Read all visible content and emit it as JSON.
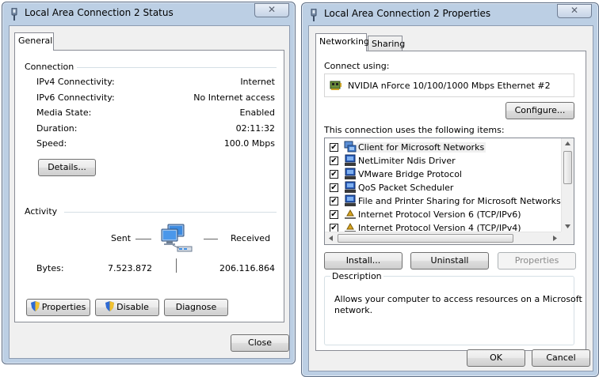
{
  "status_window": {
    "title": "Local Area Connection 2 Status",
    "close_glyph": "✕",
    "tab": "General",
    "connection": {
      "heading": "Connection",
      "rows": [
        {
          "label": "IPv4 Connectivity:",
          "value": "Internet"
        },
        {
          "label": "IPv6 Connectivity:",
          "value": "No Internet access"
        },
        {
          "label": "Media State:",
          "value": "Enabled"
        },
        {
          "label": "Duration:",
          "value": "02:11:32"
        },
        {
          "label": "Speed:",
          "value": "100.0 Mbps"
        }
      ],
      "details_button": "Details..."
    },
    "activity": {
      "heading": "Activity",
      "sent_label": "Sent",
      "received_label": "Received",
      "bytes_label": "Bytes:",
      "bytes_sent": "7.523.872",
      "bytes_received": "206.116.864"
    },
    "buttons": {
      "properties": "Properties",
      "disable": "Disable",
      "diagnose": "Diagnose",
      "close": "Close"
    }
  },
  "properties_window": {
    "title": "Local Area Connection 2 Properties",
    "close_glyph": "✕",
    "tabs": [
      "Networking",
      "Sharing"
    ],
    "connect_using_label": "Connect using:",
    "adapter_name": "NVIDIA nForce 10/100/1000 Mbps Ethernet #2",
    "configure_button": "Configure...",
    "items_label": "This connection uses the following items:",
    "items": [
      {
        "label": "Client for Microsoft Networks",
        "checked": true,
        "icon": "network-client-icon"
      },
      {
        "label": "NetLimiter Ndis Driver",
        "checked": true,
        "icon": "network-service-icon"
      },
      {
        "label": "VMware Bridge Protocol",
        "checked": true,
        "icon": "network-service-icon"
      },
      {
        "label": "QoS Packet Scheduler",
        "checked": true,
        "icon": "network-service-icon"
      },
      {
        "label": "File and Printer Sharing for Microsoft Networks",
        "checked": true,
        "icon": "network-service-icon"
      },
      {
        "label": "Internet Protocol Version 6 (TCP/IPv6)",
        "checked": true,
        "icon": "protocol-icon"
      },
      {
        "label": "Internet Protocol Version 4 (TCP/IPv4)",
        "checked": true,
        "icon": "protocol-icon"
      }
    ],
    "install_button": "Install...",
    "uninstall_button": "Uninstall",
    "properties_button": "Properties",
    "description_heading": "Description",
    "description_text_line1": "Allows your computer to access resources on a Microsoft",
    "description_text_line2": "network.",
    "ok_button": "OK",
    "cancel_button": "Cancel"
  },
  "colors": {
    "frame": "#bccfe4",
    "client": "#f0f0f0",
    "accent_blue": "#1a5fb4"
  }
}
